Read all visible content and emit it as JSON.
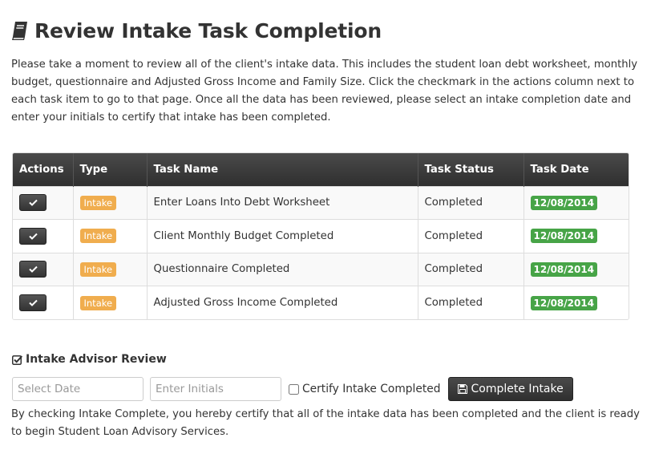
{
  "page": {
    "title": "Review Intake Task Completion",
    "title_icon": "book-icon",
    "intro": "Please take a moment to review all of the client's intake data. This includes the student loan debt worksheet, monthly budget, questionnaire and Adjusted Gross Income and Family Size. Click the checkmark in the actions column next to each task item to go to that page. Once all the data has been reviewed, please select an intake completion date and enter your initials to certify that intake has been completed."
  },
  "table": {
    "headers": {
      "actions": "Actions",
      "type": "Type",
      "task_name": "Task Name",
      "task_status": "Task Status",
      "task_date": "Task Date"
    },
    "rows": [
      {
        "type": "Intake",
        "task_name": "Enter Loans Into Debt Worksheet",
        "status": "Completed",
        "date": "12/08/2014"
      },
      {
        "type": "Intake",
        "task_name": "Client Monthly Budget Completed",
        "status": "Completed",
        "date": "12/08/2014"
      },
      {
        "type": "Intake",
        "task_name": "Questionnaire Completed",
        "status": "Completed",
        "date": "12/08/2014"
      },
      {
        "type": "Intake",
        "task_name": "Adjusted Gross Income Completed",
        "status": "Completed",
        "date": "12/08/2014"
      }
    ]
  },
  "review": {
    "heading": "Intake Advisor Review",
    "heading_icon": "checkbox-checked-icon",
    "date_placeholder": "Select Date",
    "date_value": "",
    "initials_placeholder": "Enter Initials",
    "initials_value": "",
    "certify_label": "Certify Intake Completed",
    "certify_checked": false,
    "complete_button": "Complete Intake",
    "complete_button_icon": "floppy-disk-icon",
    "note": "By checking Intake Complete, you hereby certify that all of the intake data has been completed and the client is ready to begin Student Loan Advisory Services."
  },
  "colors": {
    "intake_badge": "#f0ad4e",
    "date_badge": "#47a447",
    "header_dark": "#333333"
  }
}
